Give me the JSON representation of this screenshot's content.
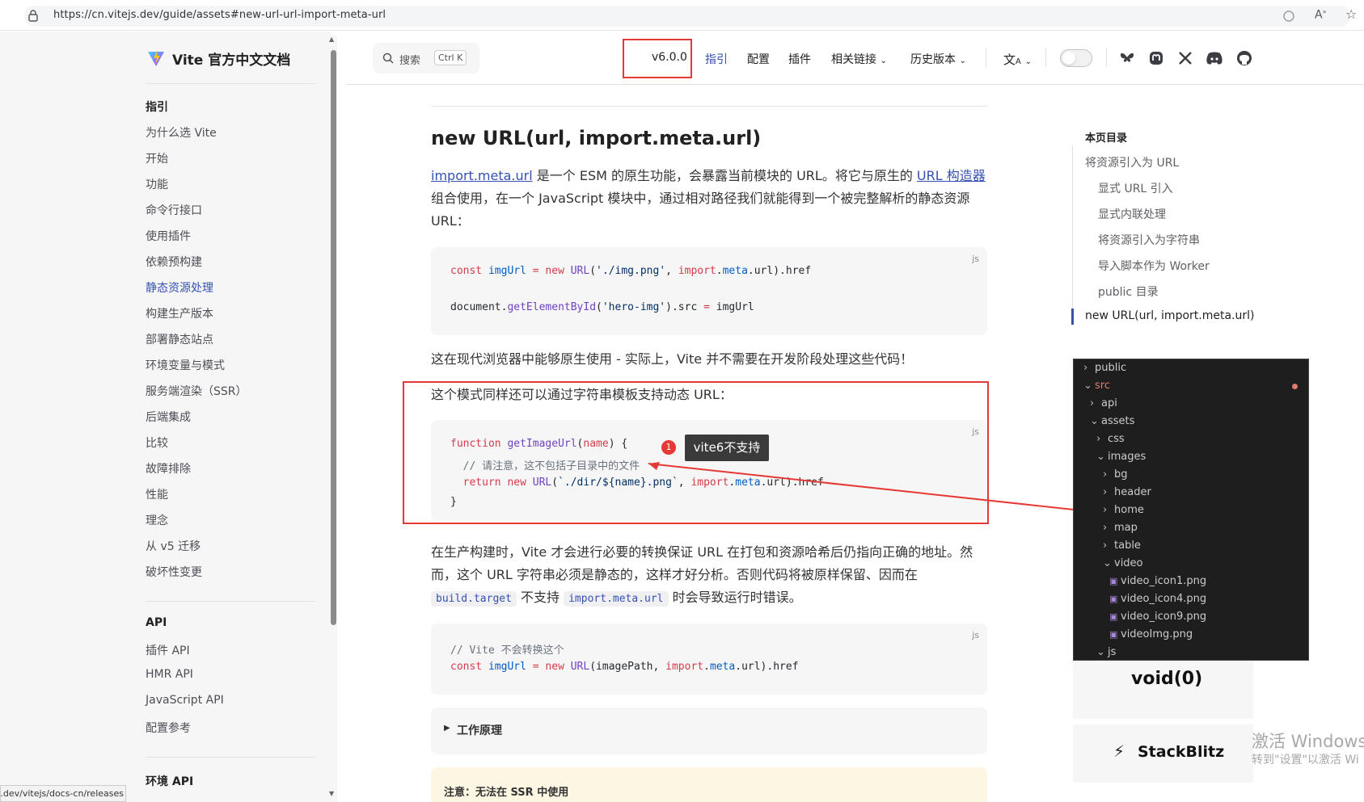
{
  "browser": {
    "url": "https://cn.vitejs.dev/guide/assets#new-url-url-import-meta-url",
    "status_url": "https://cn.vitejs.dev/vitejs/docs-cn/releases"
  },
  "site": {
    "title": "Vite 官方中文文档"
  },
  "sidebar": {
    "guide_heading": "指引",
    "guide_items": [
      "为什么选 Vite",
      "开始",
      "功能",
      "命令行接口",
      "使用插件",
      "依赖预构建",
      "静态资源处理",
      "构建生产版本",
      "部署静态站点",
      "环境变量与模式",
      "服务端渲染（SSR）",
      "后端集成",
      "比较",
      "故障排除",
      "性能",
      "理念",
      "从 v5 迁移",
      "破坏性变更"
    ],
    "active_item": "静态资源处理",
    "api_heading": "API",
    "api_items": [
      "插件 API",
      "HMR API",
      "JavaScript API",
      "配置参考"
    ],
    "env_heading": "环境 API"
  },
  "nav": {
    "search_placeholder": "搜索",
    "search_shortcut": "Ctrl K",
    "version": "v6.0.0",
    "links": [
      "指引",
      "配置",
      "插件",
      "相关链接",
      "历史版本"
    ],
    "active_link": "指引",
    "icons": [
      "translate-icon",
      "theme-toggle",
      "bluesky-icon",
      "mastodon-icon",
      "x-icon",
      "discord-icon",
      "github-icon"
    ]
  },
  "content": {
    "heading": "new URL(url, import.meta.url)",
    "intro_link1": "import.meta.url",
    "intro_text1": " 是一个 ESM 的原生功能，会暴露当前模块的 URL。将它与原生的 ",
    "intro_link2": "URL 构造器",
    "intro_text2": "组合使用，在一个 JavaScript 模块中，通过相对路径我们就能得到一个被完整解析的静态资源",
    "intro_text3": "URL：",
    "code1_lang": "js",
    "p2": "这在现代浏览器中能够原生使用 - 实际上，Vite 并不需要在开发阶段处理这些代码！",
    "p3": "这个模式同样还可以通过字符串模板支持动态 URL：",
    "code2_lang": "js",
    "annotation_number": "1",
    "annotation_text": "vite6不支持",
    "p4_line1": "在生产构建时，Vite 才会进行必要的转换保证 URL 在打包和资源哈希后仍指向正确的地址。然",
    "p4_line2": "而，这个 URL 字符串必须是静态的，这样才好分析。否则代码将被原样保留、因而在",
    "p4_code1": "build.target",
    "p4_mid": " 不支持 ",
    "p4_code2": "import.meta.url",
    "p4_end": " 时会导致运行时错误。",
    "code3_lang": "js",
    "details_label": "工作原理",
    "warning_label": "注意：无法在 SSR 中使用"
  },
  "toc": {
    "title": "本页目录",
    "items": [
      "将资源引入为 URL",
      "显式 URL 引入",
      "显式内联处理",
      "将资源引入为字符串",
      "导入脚本作为 Worker",
      "public 目录",
      "new URL(url, import.meta.url)"
    ],
    "active": "new URL(url, import.meta.url)"
  },
  "file_tree": {
    "rows": [
      {
        "label": "public",
        "chevron": ">",
        "depth": 0
      },
      {
        "label": "src",
        "chevron": "v",
        "depth": 0
      },
      {
        "label": "api",
        "chevron": ">",
        "depth": 1
      },
      {
        "label": "assets",
        "chevron": "v",
        "depth": 1
      },
      {
        "label": "css",
        "chevron": ">",
        "depth": 2
      },
      {
        "label": "images",
        "chevron": "v",
        "depth": 2
      },
      {
        "label": "bg",
        "chevron": ">",
        "depth": 3
      },
      {
        "label": "header",
        "chevron": ">",
        "depth": 3
      },
      {
        "label": "home",
        "chevron": ">",
        "depth": 3
      },
      {
        "label": "map",
        "chevron": ">",
        "depth": 3
      },
      {
        "label": "table",
        "chevron": ">",
        "depth": 3
      },
      {
        "label": "video",
        "chevron": "v",
        "depth": 3
      },
      {
        "label": "video_icon1.png",
        "chevron": "",
        "depth": 4
      },
      {
        "label": "video_icon4.png",
        "chevron": "",
        "depth": 4
      },
      {
        "label": "video_icon9.png",
        "chevron": "",
        "depth": 4
      },
      {
        "label": "videoImg.png",
        "chevron": "",
        "depth": 4
      },
      {
        "label": "js",
        "chevron": "v",
        "depth": 2
      }
    ]
  },
  "sponsors": [
    "void(0)",
    "StackBlitz"
  ],
  "watermark": {
    "line1": "激活 Windows",
    "line2": "转到\"设置\"以激活 Wi"
  },
  "colors": {
    "accent": "#3451b2",
    "annotation_red": "#e53935",
    "tree_src": "#e07b6e"
  }
}
